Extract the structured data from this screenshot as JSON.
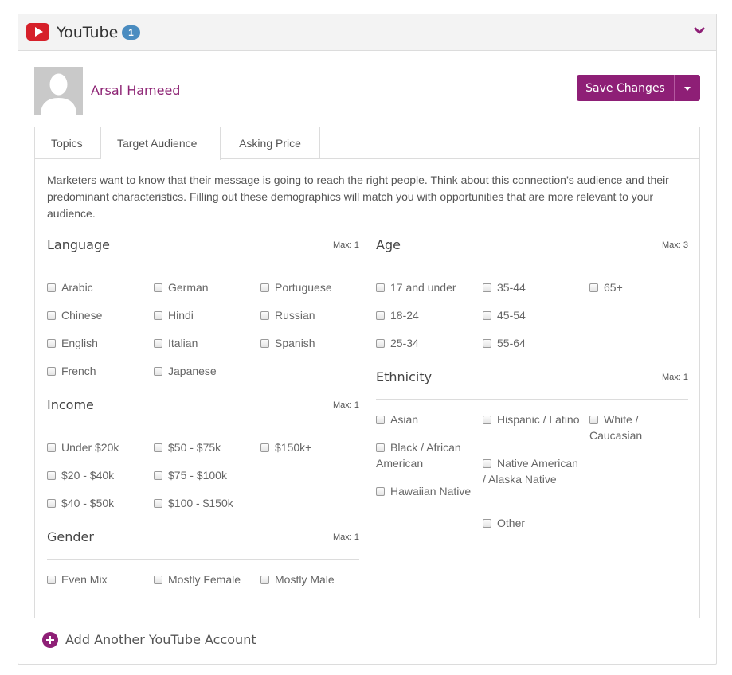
{
  "header": {
    "title": "YouTube",
    "badge": "1",
    "collapse_icon": "chevron-down-icon"
  },
  "profile": {
    "name": "Arsal Hameed",
    "avatar_icon": "user-silhouette-icon"
  },
  "actions": {
    "save_label": "Save Changes",
    "caret_icon": "caret-down-icon"
  },
  "tabs": [
    {
      "label": "Topics",
      "active": false
    },
    {
      "label": "Target Audience",
      "active": true
    },
    {
      "label": "Asking Price",
      "active": false
    }
  ],
  "intro": "Marketers want to know that their message is going to reach the right people. Think about this connection’s audience and their predominant characteristics. Filling out these demographics will match you with opportunities that are more relevant to your audience.",
  "sections": {
    "language": {
      "title": "Language",
      "max": "Max: 1",
      "options": [
        "Arabic",
        "German",
        "Portuguese",
        "Chinese",
        "Hindi",
        "Russian",
        "English",
        "Italian",
        "Spanish",
        "French",
        "Japanese"
      ]
    },
    "income": {
      "title": "Income",
      "max": "Max: 1",
      "options": [
        "Under $20k",
        "$50 - $75k",
        "$150k+",
        "$20 - $40k",
        "$75 - $100k",
        "$40 - $50k",
        "$100 - $150k"
      ]
    },
    "gender": {
      "title": "Gender",
      "max": "Max: 1",
      "options": [
        "Even Mix",
        "Mostly Female",
        "Mostly Male"
      ]
    },
    "age": {
      "title": "Age",
      "max": "Max: 3",
      "options": [
        "17 and under",
        "35-44",
        "65+",
        "18-24",
        "45-54",
        "25-34",
        "55-64"
      ]
    },
    "ethnicity": {
      "title": "Ethnicity",
      "max": "Max: 1",
      "options": [
        "Asian",
        "Hispanic / Latino",
        "White / Caucasian",
        "Black / African American",
        "Native American / Alaska Native",
        "Hawaiian Native",
        "Other"
      ]
    }
  },
  "footer": {
    "add_label": "Add Another YouTube Account",
    "add_icon": "plus-circle-icon"
  },
  "colors": {
    "brand": "#8e1f76",
    "badge": "#4a8cc0",
    "youtube": "#d6202a"
  }
}
